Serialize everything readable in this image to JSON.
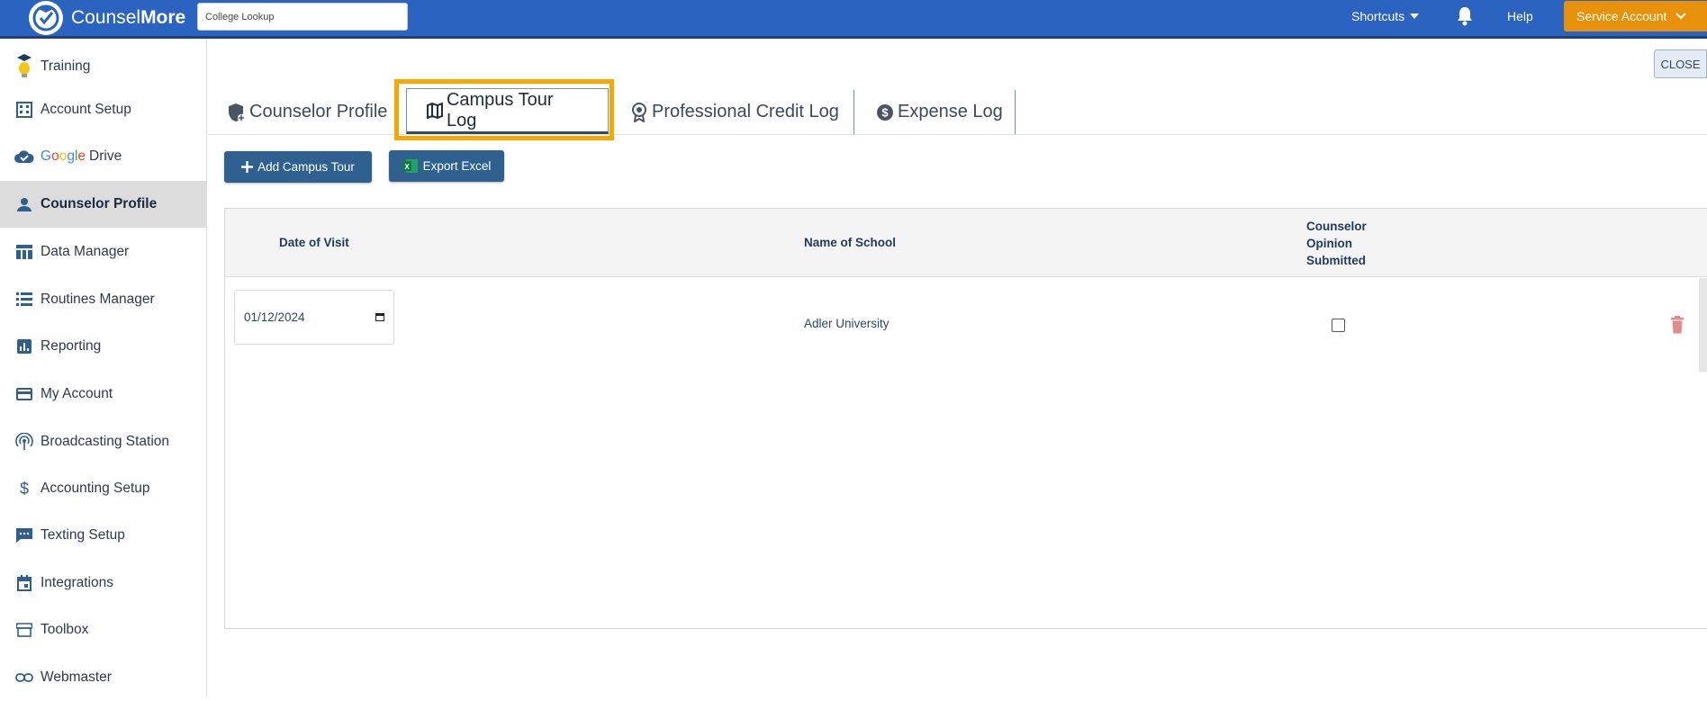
{
  "header": {
    "brand_light": "Counsel",
    "brand_bold": "More",
    "search_value": "College Lookup",
    "shortcuts_label": "Shortcuts",
    "help_label": "Help",
    "account_label": "Service Account",
    "brand_color": "#2b63c0",
    "account_color": "#e8920c"
  },
  "sidebar": {
    "items": [
      {
        "label": "Training",
        "icon": "graduation-lightbulb-icon"
      },
      {
        "label": "Account Setup",
        "icon": "building-icon"
      },
      {
        "label": "Drive",
        "prefix": "Google",
        "icon": "cloud-check-icon"
      },
      {
        "label": "Counselor Profile",
        "icon": "person-icon",
        "active": true
      },
      {
        "label": "Data Manager",
        "icon": "table-icon"
      },
      {
        "label": "Routines Manager",
        "icon": "list-icon"
      },
      {
        "label": "Reporting",
        "icon": "bar-chart-icon"
      },
      {
        "label": "My Account",
        "icon": "credit-card-icon"
      },
      {
        "label": "Broadcasting Station",
        "icon": "broadcast-icon"
      },
      {
        "label": "Accounting Setup",
        "icon": "dollar-icon"
      },
      {
        "label": "Texting Setup",
        "icon": "chat-icon"
      },
      {
        "label": "Integrations",
        "icon": "calendar-icon"
      },
      {
        "label": "Toolbox",
        "icon": "store-icon"
      },
      {
        "label": "Webmaster",
        "icon": "link-icon"
      }
    ]
  },
  "main": {
    "close_label": "CLOSE",
    "tabs": [
      {
        "label": "Counselor Profile",
        "icon": "shield-plus-icon"
      },
      {
        "label": "Campus Tour Log",
        "icon": "map-icon",
        "active": true
      },
      {
        "label": "Professional Credit Log",
        "icon": "award-icon"
      },
      {
        "label": "Expense Log",
        "icon": "dollar-circle-icon"
      }
    ],
    "add_button": "Add Campus Tour",
    "export_button": "Export Excel",
    "table": {
      "col_date": "Date of Visit",
      "col_school": "Name of School",
      "col_opinion": [
        "Counselor",
        "Opinion",
        "Submitted"
      ],
      "rows": [
        {
          "date": "01/12/2024",
          "school": "Adler University",
          "opinion_submitted": false
        }
      ]
    },
    "highlight_color": "#f5a800"
  }
}
